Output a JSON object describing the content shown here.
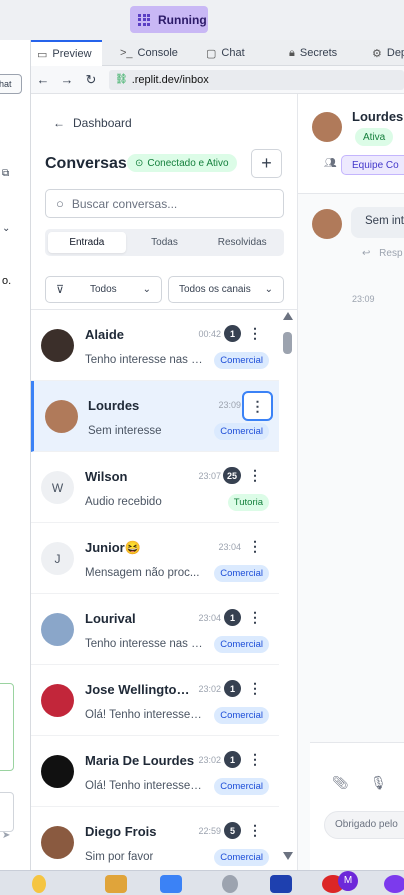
{
  "topbar": {
    "run_status": "Running"
  },
  "ide_tabs": [
    {
      "label": "Preview",
      "icon": "monitor-icon"
    },
    {
      "label": "Console",
      "icon": "terminal-icon"
    },
    {
      "label": "Chat",
      "icon": "chat-icon"
    },
    {
      "label": "Secrets",
      "icon": "lock-icon"
    },
    {
      "label": "Dep",
      "icon": "package-icon"
    }
  ],
  "left_panel": {
    "chip_label": "hat",
    "fragment_text": "o."
  },
  "url": {
    "host": ".replit.dev",
    "path": "/inbox"
  },
  "inbox": {
    "back_label": "Dashboard",
    "title": "Conversas",
    "status": "Conectado e Ativo",
    "add_label": "+",
    "search_placeholder": "Buscar conversas...",
    "tabs": [
      "Entrada",
      "Todas",
      "Resolvidas"
    ],
    "filter_status": "Todos",
    "filter_channels": "Todos os canais"
  },
  "conversations": [
    {
      "name": "Alaide",
      "time": "00:42",
      "badge": "1",
      "preview": "Tenho interesse nas p...",
      "tag": "Comercial",
      "tag_color": "blue",
      "avatar": "photo",
      "avatar_color": "#3b2f2a"
    },
    {
      "name": "Lourdes",
      "time": "23:09",
      "badge": "",
      "preview": "Sem interesse",
      "tag": "Comercial",
      "tag_color": "blue",
      "avatar": "photo",
      "avatar_color": "#b07a5a",
      "selected": true
    },
    {
      "name": "Wilson",
      "time": "23:07",
      "badge": "25",
      "preview": "Áudio recebido",
      "tag": "Tutoria",
      "tag_color": "green",
      "avatar": "W"
    },
    {
      "name": "Junior😆",
      "time": "23:04",
      "badge": "",
      "preview": "Mensagem não proc...",
      "tag": "Comercial",
      "tag_color": "blue",
      "avatar": "J"
    },
    {
      "name": "Lourival",
      "time": "23:04",
      "badge": "1",
      "preview": "Tenho interesse nas p...",
      "tag": "Comercial",
      "tag_color": "blue",
      "avatar": "photo",
      "avatar_color": "#8aa6c9"
    },
    {
      "name": "Jose Wellington...",
      "time": "23:02",
      "badge": "1",
      "preview": "Olá! Tenho interesse ...",
      "tag": "Comercial",
      "tag_color": "blue",
      "avatar": "photo",
      "avatar_color": "#c2263a"
    },
    {
      "name": "Maria De Lourdes",
      "time": "23:02",
      "badge": "1",
      "preview": "Olá! Tenho interesse ...",
      "tag": "Comercial",
      "tag_color": "blue",
      "avatar": "photo",
      "avatar_color": "#111111"
    },
    {
      "name": "Diego Frois",
      "time": "22:59",
      "badge": "5",
      "preview": "Sim por favor",
      "tag": "Comercial",
      "tag_color": "blue",
      "avatar": "photo",
      "avatar_color": "#8a5a40"
    }
  ],
  "chat": {
    "contact_name": "Lourdes",
    "status": "Ativa",
    "team": "Equipe Co",
    "message": "Sem inte",
    "reply_label": "Resp",
    "message_time": "23:09",
    "quick_reply": "Obrigado pelo"
  },
  "colors": {
    "accent": "#3b82f6",
    "status_green": "#15803d",
    "tag_blue": "#1d4ed8",
    "running": "#c9b8f5"
  }
}
